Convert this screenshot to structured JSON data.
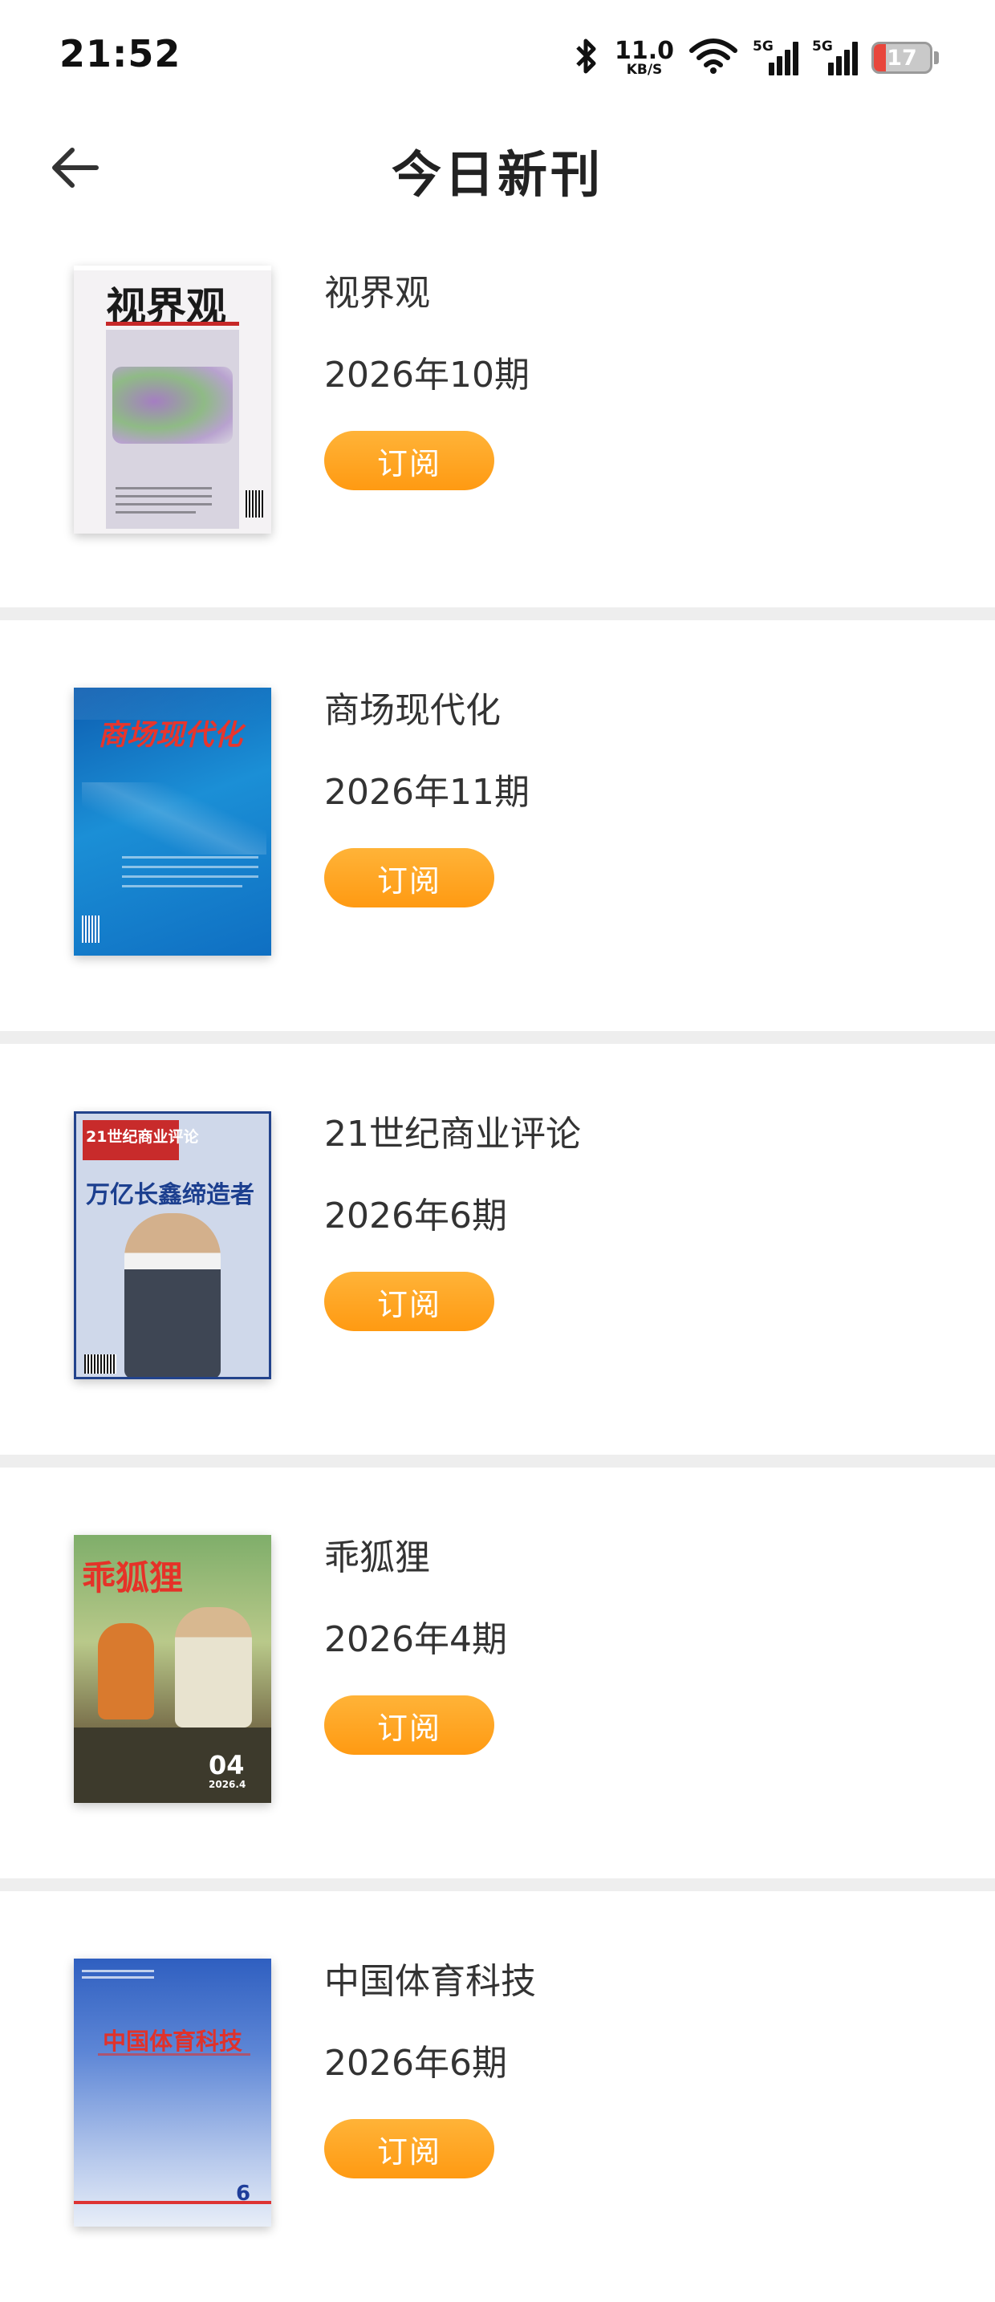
{
  "status_bar": {
    "time": "21:52",
    "net_speed_value": "11.0",
    "net_speed_unit": "KB/S",
    "signal_1_label": "5G",
    "signal_2_label": "5G",
    "battery_level": "17",
    "battery_color": "#e8463c"
  },
  "header": {
    "title": "今日新刊",
    "back_icon": "arrow-left-icon"
  },
  "accent_color": "#ff9a12",
  "magazines": [
    {
      "name": "视界观",
      "issue": "2026年10期",
      "subscribe_label": "订阅",
      "cover_title": "视界观"
    },
    {
      "name": "商场现代化",
      "issue": "2026年11期",
      "subscribe_label": "订阅",
      "cover_title": "商场现代化"
    },
    {
      "name": "21世纪商业评论",
      "issue": "2026年6期",
      "subscribe_label": "订阅",
      "cover_title": "21世纪商业评论",
      "cover_headline": "万亿长鑫缔造者"
    },
    {
      "name": "乖狐狸",
      "issue": "2026年4期",
      "subscribe_label": "订阅",
      "cover_title": "乖狐狸",
      "cover_issue_no": "04",
      "cover_year": "2026.4"
    },
    {
      "name": "中国体育科技",
      "issue": "2026年6期",
      "subscribe_label": "订阅",
      "cover_title": "中国体育科技",
      "cover_issue_no": "6"
    }
  ]
}
